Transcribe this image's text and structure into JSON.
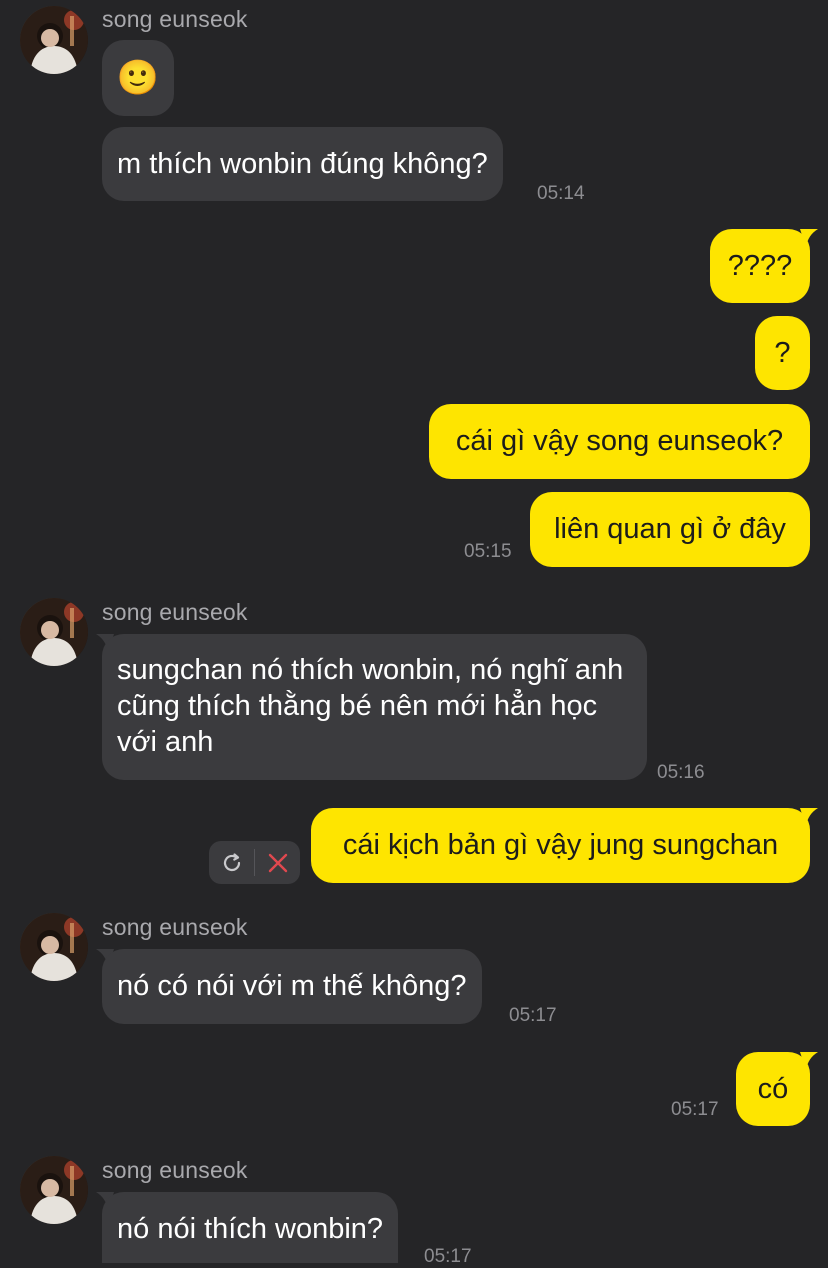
{
  "contact": {
    "name": "song eunseok"
  },
  "messages": {
    "m1": {
      "sender": "song eunseok",
      "emoji": "🙂"
    },
    "m2": {
      "text": "m thích wonbin đúng không?",
      "time": "05:14"
    },
    "m3": {
      "text": "????"
    },
    "m4": {
      "text": "?"
    },
    "m5": {
      "text": "cái gì vậy song eunseok?"
    },
    "m6": {
      "text": "liên quan gì ở đây",
      "time": "05:15"
    },
    "m7": {
      "sender": "song eunseok",
      "text": "sungchan nó thích wonbin, nó nghĩ anh cũng thích thằng bé nên mới hẳn học với anh",
      "time": "05:16"
    },
    "m8": {
      "text": "cái kịch bản gì vậy jung sungchan",
      "status": "failed"
    },
    "m9": {
      "sender": "song eunseok",
      "text": "nó có nói với m thế không?",
      "time": "05:17"
    },
    "m10": {
      "text": "có",
      "time": "05:17"
    },
    "m11": {
      "sender": "song eunseok",
      "text": "nó nói thích wonbin?",
      "time": "05:17"
    }
  },
  "colors": {
    "background": "#252527",
    "incoming_bubble": "#3b3b3e",
    "outgoing_bubble": "#fee500",
    "delete_icon": "#e0484f"
  },
  "icons": {
    "retry": "retry-icon",
    "delete": "close-icon"
  }
}
